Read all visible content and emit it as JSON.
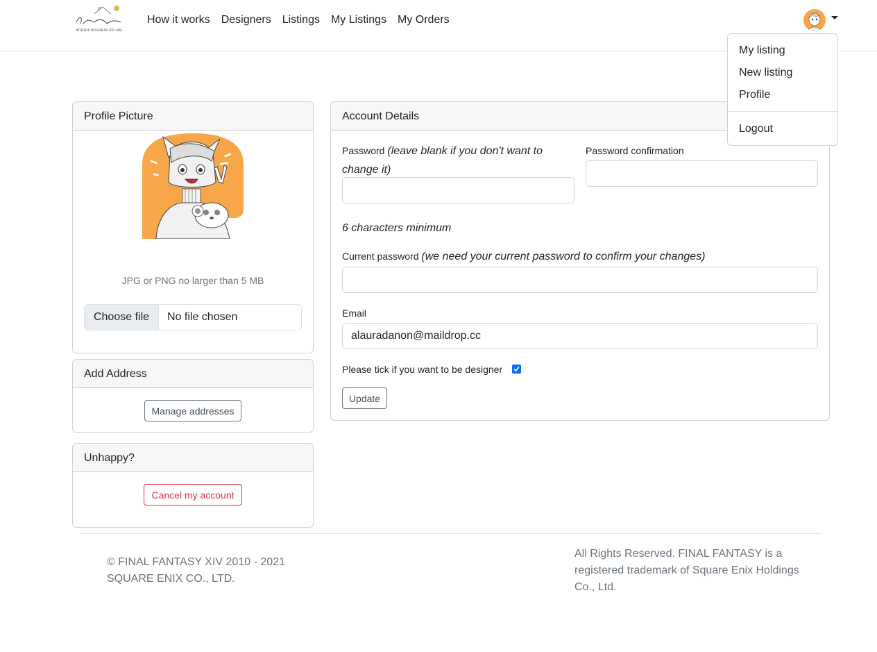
{
  "nav": {
    "logo_text": "Enzen Manes",
    "logo_subtitle": "INTERIOR DESIGNERS FOR HIRE",
    "links": [
      "How it works",
      "Designers",
      "Listings",
      "My Listings",
      "My Orders"
    ]
  },
  "dropdown": {
    "items": [
      "My listing",
      "New listing",
      "Profile"
    ],
    "logout": "Logout"
  },
  "profile_card": {
    "title": "Profile Picture",
    "hint": "JPG or PNG no larger than 5 MB",
    "choose_file": "Choose file",
    "file_name": "No file chosen"
  },
  "address_card": {
    "title": "Add Address",
    "button": "Manage addresses"
  },
  "unhappy_card": {
    "title": "Unhappy?",
    "button": "Cancel my account"
  },
  "account": {
    "title": "Account Details",
    "password_label": "Password",
    "password_note": "(leave blank if you don't want to change it)",
    "password_confirm_label": "Password confirmation",
    "min_chars": "6 characters minimum",
    "current_password_label": "Current password",
    "current_password_note": "(we need your current password to confirm your changes)",
    "email_label": "Email",
    "email_value": "alauradanon@maildrop.cc",
    "designer_label": "Please tick if you want to be designer",
    "designer_checked": true,
    "update_button": "Update"
  },
  "footer": {
    "left": "© FINAL FANTASY XIV 2010 - 2021 SQUARE ENIX CO., LTD.",
    "right": "All Rights Reserved. FINAL FANTASY is a registered trademark of Square Enix Holdings Co., Ltd."
  },
  "colors": {
    "accent": "#0d6efd",
    "danger": "#dc3545",
    "avatar_orange": "#f7a64a"
  }
}
